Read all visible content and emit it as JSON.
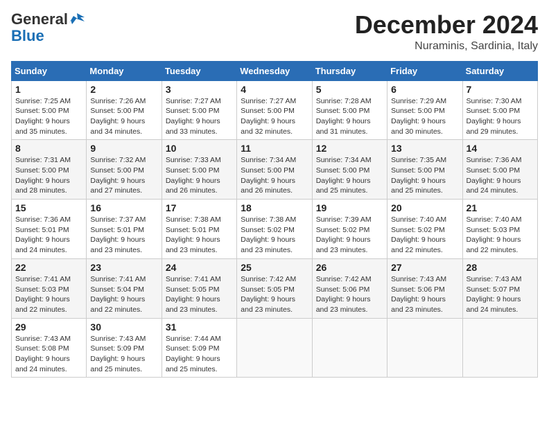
{
  "header": {
    "logo_general": "General",
    "logo_blue": "Blue",
    "month_title": "December 2024",
    "location": "Nuraminis, Sardinia, Italy"
  },
  "calendar": {
    "days_of_week": [
      "Sunday",
      "Monday",
      "Tuesday",
      "Wednesday",
      "Thursday",
      "Friday",
      "Saturday"
    ],
    "weeks": [
      [
        {
          "day": "1",
          "sunrise": "7:25 AM",
          "sunset": "5:00 PM",
          "daylight": "9 hours and 35 minutes."
        },
        {
          "day": "2",
          "sunrise": "7:26 AM",
          "sunset": "5:00 PM",
          "daylight": "9 hours and 34 minutes."
        },
        {
          "day": "3",
          "sunrise": "7:27 AM",
          "sunset": "5:00 PM",
          "daylight": "9 hours and 33 minutes."
        },
        {
          "day": "4",
          "sunrise": "7:27 AM",
          "sunset": "5:00 PM",
          "daylight": "9 hours and 32 minutes."
        },
        {
          "day": "5",
          "sunrise": "7:28 AM",
          "sunset": "5:00 PM",
          "daylight": "9 hours and 31 minutes."
        },
        {
          "day": "6",
          "sunrise": "7:29 AM",
          "sunset": "5:00 PM",
          "daylight": "9 hours and 30 minutes."
        },
        {
          "day": "7",
          "sunrise": "7:30 AM",
          "sunset": "5:00 PM",
          "daylight": "9 hours and 29 minutes."
        }
      ],
      [
        {
          "day": "8",
          "sunrise": "7:31 AM",
          "sunset": "5:00 PM",
          "daylight": "9 hours and 28 minutes."
        },
        {
          "day": "9",
          "sunrise": "7:32 AM",
          "sunset": "5:00 PM",
          "daylight": "9 hours and 27 minutes."
        },
        {
          "day": "10",
          "sunrise": "7:33 AM",
          "sunset": "5:00 PM",
          "daylight": "9 hours and 26 minutes."
        },
        {
          "day": "11",
          "sunrise": "7:34 AM",
          "sunset": "5:00 PM",
          "daylight": "9 hours and 26 minutes."
        },
        {
          "day": "12",
          "sunrise": "7:34 AM",
          "sunset": "5:00 PM",
          "daylight": "9 hours and 25 minutes."
        },
        {
          "day": "13",
          "sunrise": "7:35 AM",
          "sunset": "5:00 PM",
          "daylight": "9 hours and 25 minutes."
        },
        {
          "day": "14",
          "sunrise": "7:36 AM",
          "sunset": "5:00 PM",
          "daylight": "9 hours and 24 minutes."
        }
      ],
      [
        {
          "day": "15",
          "sunrise": "7:36 AM",
          "sunset": "5:01 PM",
          "daylight": "9 hours and 24 minutes."
        },
        {
          "day": "16",
          "sunrise": "7:37 AM",
          "sunset": "5:01 PM",
          "daylight": "9 hours and 23 minutes."
        },
        {
          "day": "17",
          "sunrise": "7:38 AM",
          "sunset": "5:01 PM",
          "daylight": "9 hours and 23 minutes."
        },
        {
          "day": "18",
          "sunrise": "7:38 AM",
          "sunset": "5:02 PM",
          "daylight": "9 hours and 23 minutes."
        },
        {
          "day": "19",
          "sunrise": "7:39 AM",
          "sunset": "5:02 PM",
          "daylight": "9 hours and 23 minutes."
        },
        {
          "day": "20",
          "sunrise": "7:40 AM",
          "sunset": "5:02 PM",
          "daylight": "9 hours and 22 minutes."
        },
        {
          "day": "21",
          "sunrise": "7:40 AM",
          "sunset": "5:03 PM",
          "daylight": "9 hours and 22 minutes."
        }
      ],
      [
        {
          "day": "22",
          "sunrise": "7:41 AM",
          "sunset": "5:03 PM",
          "daylight": "9 hours and 22 minutes."
        },
        {
          "day": "23",
          "sunrise": "7:41 AM",
          "sunset": "5:04 PM",
          "daylight": "9 hours and 22 minutes."
        },
        {
          "day": "24",
          "sunrise": "7:41 AM",
          "sunset": "5:05 PM",
          "daylight": "9 hours and 23 minutes."
        },
        {
          "day": "25",
          "sunrise": "7:42 AM",
          "sunset": "5:05 PM",
          "daylight": "9 hours and 23 minutes."
        },
        {
          "day": "26",
          "sunrise": "7:42 AM",
          "sunset": "5:06 PM",
          "daylight": "9 hours and 23 minutes."
        },
        {
          "day": "27",
          "sunrise": "7:43 AM",
          "sunset": "5:06 PM",
          "daylight": "9 hours and 23 minutes."
        },
        {
          "day": "28",
          "sunrise": "7:43 AM",
          "sunset": "5:07 PM",
          "daylight": "9 hours and 24 minutes."
        }
      ],
      [
        {
          "day": "29",
          "sunrise": "7:43 AM",
          "sunset": "5:08 PM",
          "daylight": "9 hours and 24 minutes."
        },
        {
          "day": "30",
          "sunrise": "7:43 AM",
          "sunset": "5:09 PM",
          "daylight": "9 hours and 25 minutes."
        },
        {
          "day": "31",
          "sunrise": "7:44 AM",
          "sunset": "5:09 PM",
          "daylight": "9 hours and 25 minutes."
        },
        null,
        null,
        null,
        null
      ]
    ]
  },
  "labels": {
    "sunrise_label": "Sunrise:",
    "sunset_label": "Sunset:",
    "daylight_label": "Daylight:"
  }
}
